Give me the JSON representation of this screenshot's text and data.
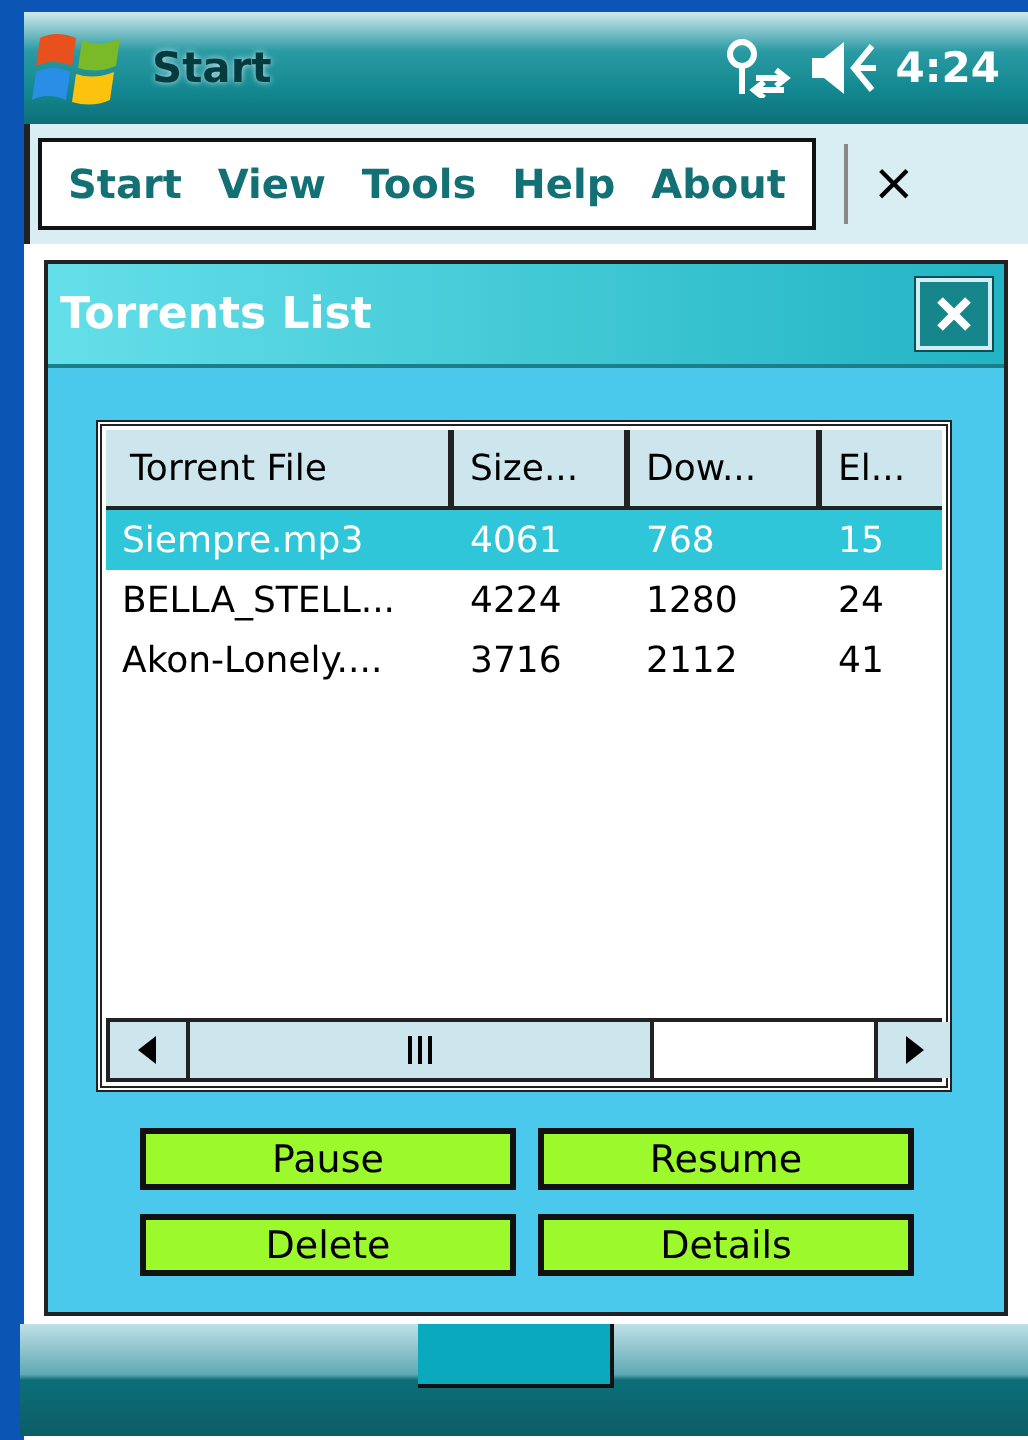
{
  "title_bar": {
    "title": "Start",
    "time": "4:24"
  },
  "menu": {
    "items": [
      "Start",
      "View",
      "Tools",
      "Help",
      "About"
    ],
    "close": "×"
  },
  "dialog": {
    "title": "Torrents List",
    "columns": [
      "Torrent File",
      "Size...",
      "Dow...",
      "El..."
    ],
    "rows": [
      {
        "cells": [
          "Siempre.mp3",
          "4061",
          "768",
          "15"
        ],
        "selected": true
      },
      {
        "cells": [
          "BELLA_STELL...",
          "4224",
          "1280",
          "24"
        ],
        "selected": false
      },
      {
        "cells": [
          "Akon-Lonely....",
          "3716",
          "2112",
          "41"
        ],
        "selected": false
      }
    ],
    "buttons": [
      "Pause",
      "Resume",
      "Delete",
      "Details"
    ]
  }
}
